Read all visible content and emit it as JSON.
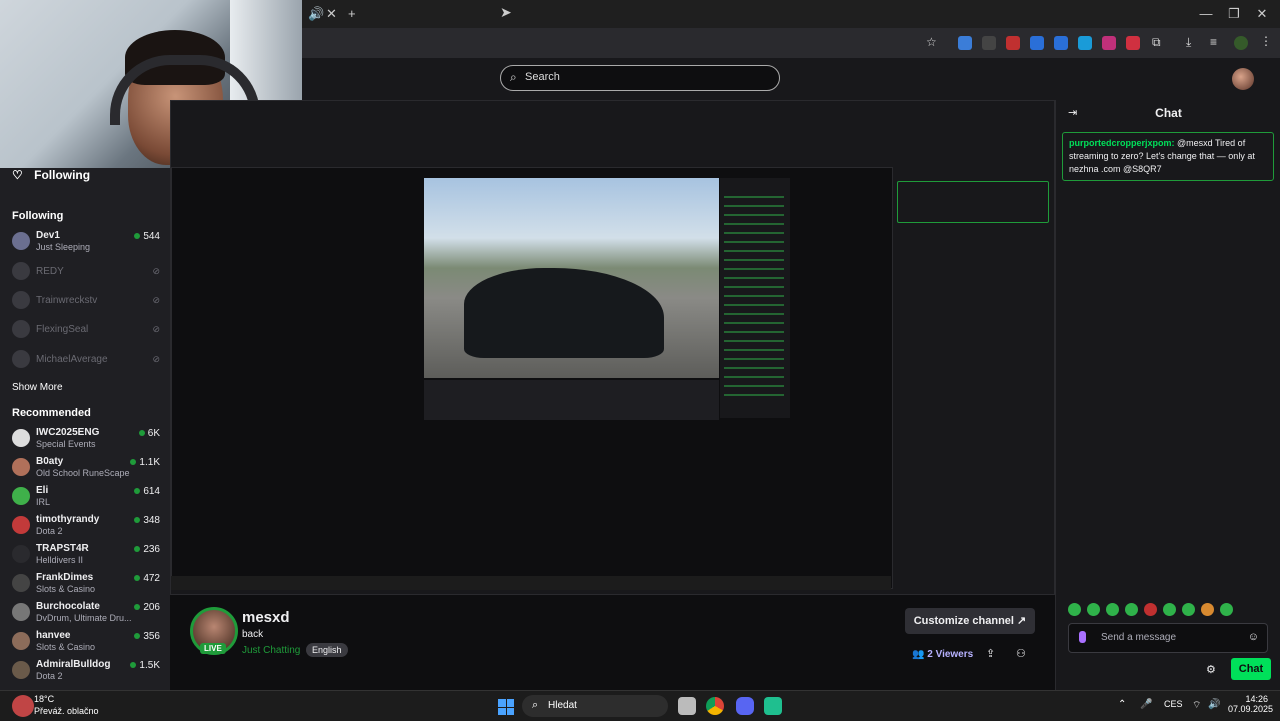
{
  "browser": {
    "search_placeholder": "Search"
  },
  "sidebar": {
    "following_header": "Following",
    "following_section": "Following",
    "following": [
      {
        "name": "Dev1",
        "sub": "Just Sleeping",
        "viewers": "544",
        "live": true
      },
      {
        "name": "REDY",
        "live": false
      },
      {
        "name": "Trainwreckstv",
        "live": false
      },
      {
        "name": "FlexingSeal",
        "live": false
      },
      {
        "name": "MichaelAverage",
        "live": false
      }
    ],
    "show_more": "Show More",
    "recommended_section": "Recommended",
    "recommended": [
      {
        "name": "IWC2025ENG",
        "sub": "Special Events",
        "viewers": "6K"
      },
      {
        "name": "B0aty",
        "sub": "Old School RuneScape",
        "viewers": "1.1K"
      },
      {
        "name": "Eli",
        "sub": "IRL",
        "viewers": "614"
      },
      {
        "name": "timothyrandy",
        "sub": "Dota 2",
        "viewers": "348"
      },
      {
        "name": "TRAPST4R",
        "sub": "Helldivers II",
        "viewers": "236"
      },
      {
        "name": "FrankDimes",
        "sub": "Slots & Casino",
        "viewers": "472"
      },
      {
        "name": "Burchocolate",
        "sub": "DvDrum, Ultimate Dru...",
        "viewers": "206"
      },
      {
        "name": "hanvee",
        "sub": "Slots & Casino",
        "viewers": "356"
      },
      {
        "name": "AdmiralBulldog",
        "sub": "Dota 2",
        "viewers": "1.5K"
      }
    ]
  },
  "stream": {
    "name": "mesxd",
    "title": "back",
    "category": "Just Chatting",
    "language": "English",
    "live_badge": "LIVE",
    "customize_label": "Customize channel",
    "viewers_count": "2",
    "viewers_label": "Viewers"
  },
  "chat": {
    "title": "Chat",
    "message_user": "purportedcropperjxpom:",
    "message_text": "@mesxd Tired of streaming to zero? Let's change that — only at nezhna .com @S8QR7",
    "input_placeholder": "Send a message",
    "send_label": "Chat"
  },
  "taskbar": {
    "temperature": "18°C",
    "condition": "Převáž. oblačno",
    "search_placeholder": "Hledat",
    "language": "CES",
    "time": "14:26",
    "date": "07.09.2025"
  },
  "colors": {
    "accent_green": "#00e05a",
    "live_green": "#1f9b3a",
    "viewer_purple": "#b7b2ff"
  }
}
